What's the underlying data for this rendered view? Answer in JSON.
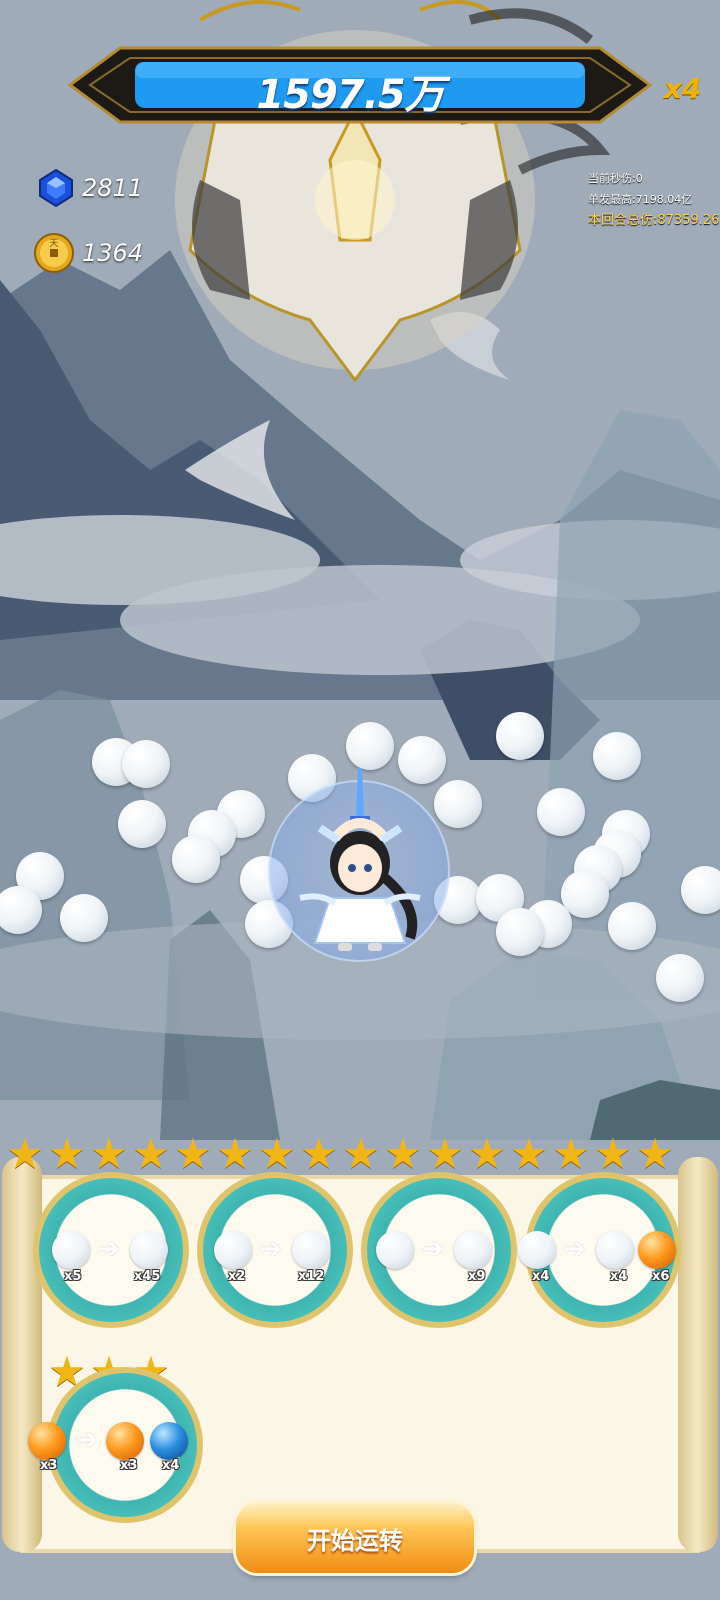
{
  "boss": {
    "hp_text": "1597.5万",
    "multiplier": "x4"
  },
  "resources": {
    "gems": "2811",
    "coins": "1364",
    "coin_glyph": "天"
  },
  "stats": {
    "dps_line": "当前秒伤:0",
    "max_hit_line": "单发最高:7198.04亿",
    "round_total_line": "本回合总伤:87359.26"
  },
  "recipes": [
    {
      "inputs_count": "x5",
      "outputs": [
        "x45"
      ],
      "types": [
        "white",
        "white"
      ]
    },
    {
      "inputs_count": "x2",
      "outputs": [
        "x12"
      ],
      "types": [
        "white",
        "white"
      ]
    },
    {
      "inputs_count": "",
      "outputs": [
        "x9"
      ],
      "types": [
        "white",
        "white"
      ]
    },
    {
      "inputs_count": "x4",
      "outputs": [
        "x4",
        "x6"
      ],
      "types": [
        "white",
        "white",
        "orange"
      ]
    },
    {
      "inputs_count": "x3",
      "outputs": [
        "x3",
        "x4"
      ],
      "types": [
        "orange",
        "orange",
        "blue"
      ]
    }
  ],
  "star_rows": {
    "top_count": 16,
    "second_row_count": 3
  },
  "start_button": {
    "label": "开始运转"
  },
  "colors": {
    "hp_fill": "#1e9bf0",
    "gold": "#f0b400",
    "teal": "#3fb4b0",
    "button": "#f5a623"
  }
}
